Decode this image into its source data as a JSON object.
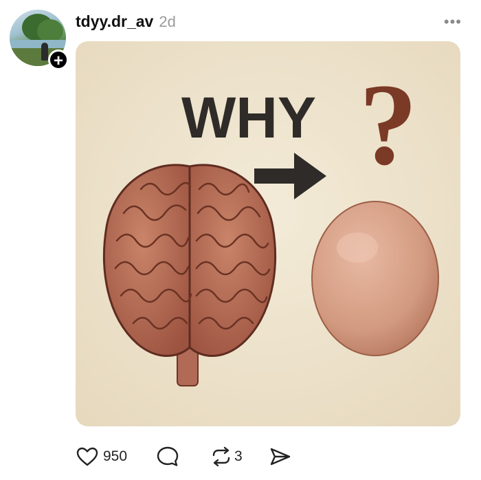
{
  "post": {
    "username": "tdyy.dr_av",
    "time": "2d",
    "more_icon": "more-horizontal-icon",
    "follow_icon": "plus-icon",
    "image": {
      "headline": "WHY",
      "question_mark": "?",
      "colors": {
        "background": "#ede2cd",
        "brain": "#b86a55",
        "egg": "#d9a088",
        "ink": "#2e2b28",
        "question": "#7a3a26"
      }
    },
    "actions": {
      "like": {
        "icon": "heart-icon",
        "count": "950"
      },
      "comment": {
        "icon": "comment-icon"
      },
      "repost": {
        "icon": "repost-icon",
        "count": "3"
      },
      "share": {
        "icon": "send-icon"
      }
    }
  }
}
